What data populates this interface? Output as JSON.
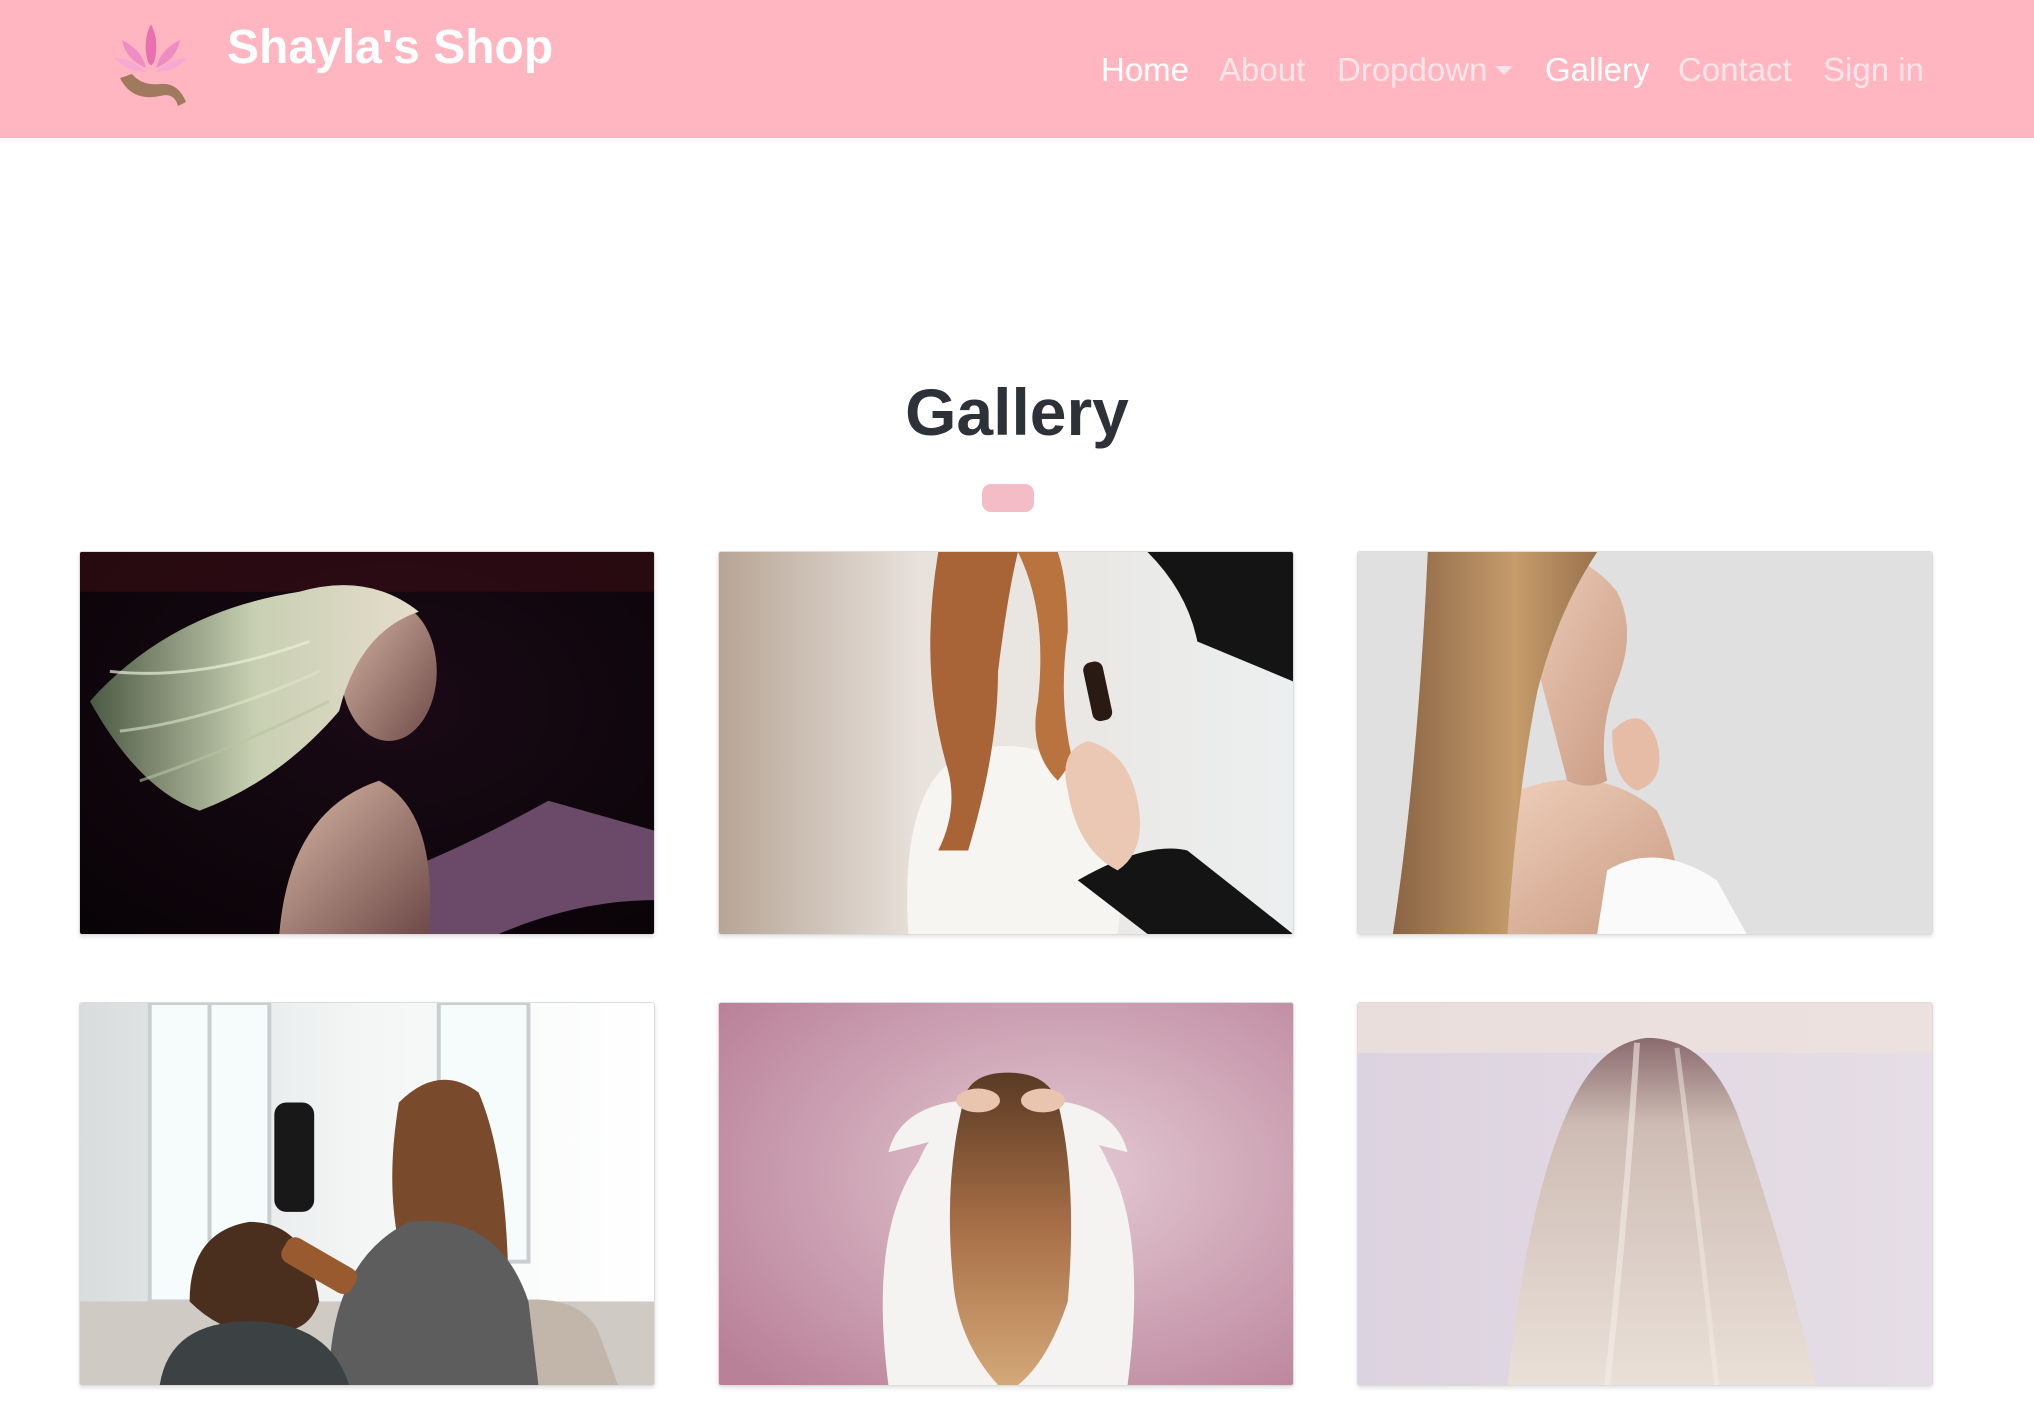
{
  "brand": {
    "name": "Shayla's Shop"
  },
  "nav": {
    "items": [
      {
        "label": "Home",
        "active": true
      },
      {
        "label": "About",
        "active": false
      },
      {
        "label": "Dropdown",
        "active": false,
        "has_caret": true
      },
      {
        "label": "Gallery",
        "active": true
      },
      {
        "label": "Contact",
        "active": false
      },
      {
        "label": "Sign in",
        "active": false
      }
    ]
  },
  "page": {
    "title": "Gallery"
  },
  "colors": {
    "navbar_bg": "#ffb6c1",
    "title_text": "#2d3138",
    "divider": "#f4bcc7"
  },
  "gallery": {
    "photos": [
      {
        "name": "photo-windblown-blonde-hair"
      },
      {
        "name": "photo-hairstyling-curls"
      },
      {
        "name": "photo-straight-brown-hair-profile"
      },
      {
        "name": "photo-salon-blow-dry"
      },
      {
        "name": "photo-wavy-hair-back-pink-wall"
      },
      {
        "name": "photo-sleek-blonde-hair-back"
      }
    ]
  }
}
